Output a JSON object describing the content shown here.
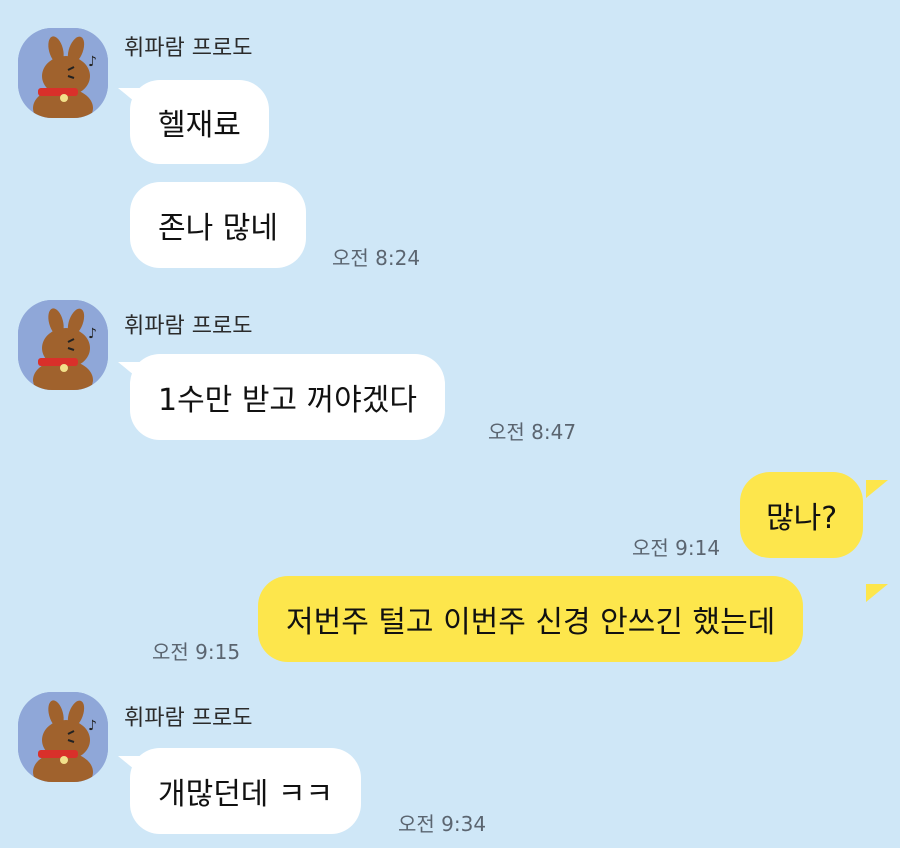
{
  "colors": {
    "background": "#cfe7f7",
    "my_bubble": "#fde64c",
    "their_bubble": "#ffffff",
    "avatar_bg": "#8fa7d8"
  },
  "messages": [
    {
      "sender": "휘파람 프로도",
      "avatar": "frodo-avatar-icon",
      "bubbles": [
        "헬재료",
        "존나 많네"
      ],
      "time": "오전 8:24"
    },
    {
      "sender": "휘파람 프로도",
      "avatar": "frodo-avatar-icon",
      "bubbles": [
        "1수만 받고 꺼야겠다"
      ],
      "time": "오전 8:47"
    },
    {
      "mine": true,
      "bubbles": [
        "많나?"
      ],
      "time": "오전 9:14"
    },
    {
      "mine": true,
      "bubbles": [
        "저번주 털고 이번주 신경 안쓰긴 했는데"
      ],
      "time": "오전 9:15"
    },
    {
      "sender": "휘파람 프로도",
      "avatar": "frodo-avatar-icon",
      "bubbles": [
        "개많던데 ㅋㅋ"
      ],
      "time": "오전 9:34"
    }
  ]
}
